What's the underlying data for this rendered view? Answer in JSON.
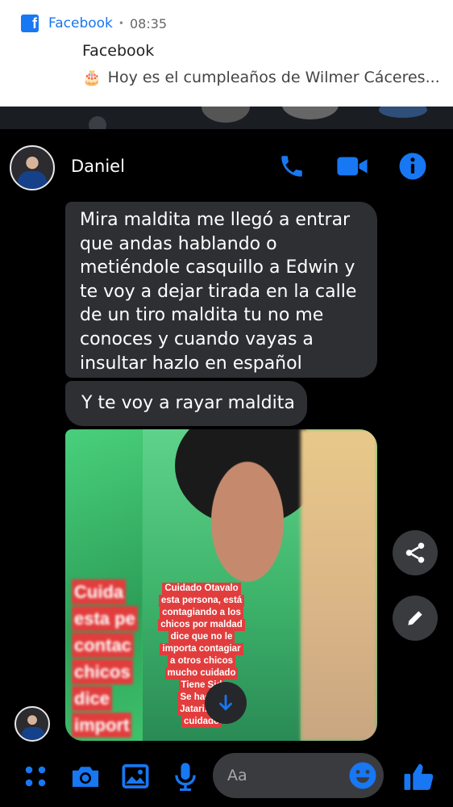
{
  "notification": {
    "app_name": "Facebook",
    "separator": "•",
    "time": "08:35",
    "title": "Facebook",
    "body": "Hoy es el cumpleaños de Wilmer Cáceres...",
    "cake_emoji": "🎂"
  },
  "header": {
    "contact_name": "Daniel",
    "icons": [
      "phone-icon",
      "video-camera-icon",
      "info-icon"
    ]
  },
  "messages": [
    {
      "lines": [
        "Mira maldita me llegó a entrar",
        "que andas hablando o",
        "metiéndole casquillo a Edwin y",
        "te voy a dejar tirada en la calle",
        "de un tiro maldita tu no me",
        "conoces y cuando vayas a",
        "insultar hazlo en español"
      ]
    },
    {
      "text": "Y te voy a rayar maldita"
    }
  ],
  "photo": {
    "left_overlay_lines": [
      "Cuida",
      "esta pe",
      "contac",
      "chicos",
      "dice",
      "import"
    ],
    "caption_lines": [
      "Cuidado Otavalo",
      "esta persona, está",
      "contagiando a los",
      "chicos por maldad",
      "dice que no le",
      "importa contagiar",
      "a otros chicos",
      "mucho cuidado",
      "Tiene Sid",
      "Se hace ll",
      "Jatari. Mu",
      "cuidado"
    ]
  },
  "composer": {
    "placeholder": "Aa",
    "icons": [
      "menu-dots-icon",
      "camera-icon",
      "gallery-icon",
      "microphone-icon",
      "emoji-icon",
      "like-icon"
    ]
  },
  "colors": {
    "accent": "#1877f2",
    "bubble": "#2e2f33",
    "background": "#000000",
    "caption_red": "#e23d3d"
  }
}
